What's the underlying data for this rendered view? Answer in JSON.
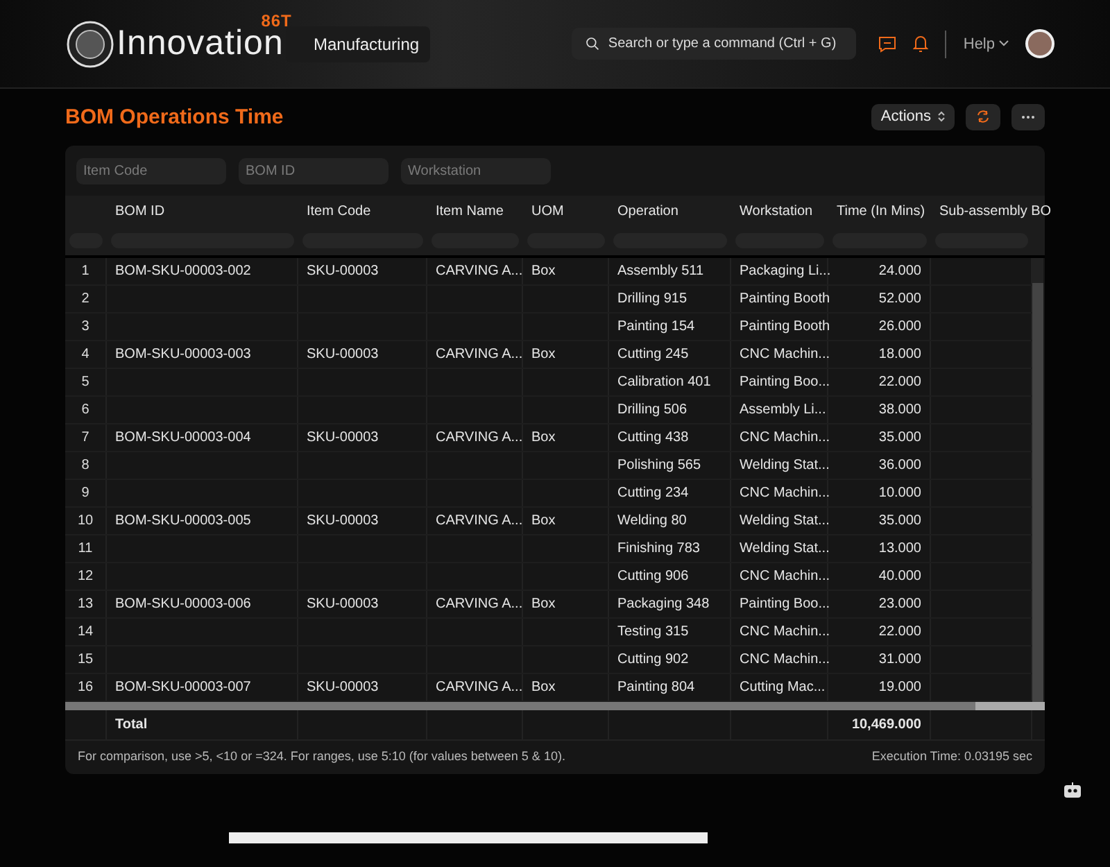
{
  "topbar": {
    "brand": "Innovation",
    "brand_badge": "86T",
    "breadcrumb": "Manufacturing",
    "search": {
      "placeholder": "Search or type a command (Ctrl + G)"
    },
    "help": "Help"
  },
  "page": {
    "title": "BOM Operations Time",
    "actions": "Actions"
  },
  "filters": [
    {
      "placeholder": "Item Code"
    },
    {
      "placeholder": "BOM ID"
    },
    {
      "placeholder": "Workstation"
    }
  ],
  "table": {
    "columns": [
      {
        "label": "BOM ID",
        "kind": "text"
      },
      {
        "label": "Item Code",
        "kind": "text"
      },
      {
        "label": "Item Name",
        "kind": "text"
      },
      {
        "label": "UOM",
        "kind": "text"
      },
      {
        "label": "Operation",
        "kind": "text"
      },
      {
        "label": "Workstation",
        "kind": "text"
      },
      {
        "label": "Time (In Mins)",
        "kind": "number"
      },
      {
        "label": "Sub-assembly BO",
        "kind": "text"
      }
    ],
    "rows": [
      {
        "index": "1",
        "bom_id": "BOM-SKU-00003-002",
        "item_code": "SKU-00003",
        "item_name": "CARVING A...",
        "uom": "Box",
        "operation": "Assembly 511",
        "workstation": "Packaging Li...",
        "time": "24.000"
      },
      {
        "index": "2",
        "operation": "Drilling 915",
        "workstation": "Painting Booth",
        "time": "52.000"
      },
      {
        "index": "3",
        "operation": "Painting 154",
        "workstation": "Painting Booth",
        "time": "26.000"
      },
      {
        "index": "4",
        "bom_id": "BOM-SKU-00003-003",
        "item_code": "SKU-00003",
        "item_name": "CARVING A...",
        "uom": "Box",
        "operation": "Cutting 245",
        "workstation": "CNC Machin...",
        "time": "18.000"
      },
      {
        "index": "5",
        "operation": "Calibration 401",
        "workstation": "Painting Boo...",
        "time": "22.000"
      },
      {
        "index": "6",
        "operation": "Drilling 506",
        "workstation": "Assembly Li...",
        "time": "38.000"
      },
      {
        "index": "7",
        "bom_id": "BOM-SKU-00003-004",
        "item_code": "SKU-00003",
        "item_name": "CARVING A...",
        "uom": "Box",
        "operation": "Cutting 438",
        "workstation": "CNC Machin...",
        "time": "35.000"
      },
      {
        "index": "8",
        "operation": "Polishing 565",
        "workstation": "Welding Stat...",
        "time": "36.000"
      },
      {
        "index": "9",
        "operation": "Cutting 234",
        "workstation": "CNC Machin...",
        "time": "10.000"
      },
      {
        "index": "10",
        "bom_id": "BOM-SKU-00003-005",
        "item_code": "SKU-00003",
        "item_name": "CARVING A...",
        "uom": "Box",
        "operation": "Welding 80",
        "workstation": "Welding Stat...",
        "time": "35.000"
      },
      {
        "index": "11",
        "operation": "Finishing 783",
        "workstation": "Welding Stat...",
        "time": "13.000"
      },
      {
        "index": "12",
        "operation": "Cutting 906",
        "workstation": "CNC Machin...",
        "time": "40.000"
      },
      {
        "index": "13",
        "bom_id": "BOM-SKU-00003-006",
        "item_code": "SKU-00003",
        "item_name": "CARVING A...",
        "uom": "Box",
        "operation": "Packaging 348",
        "workstation": "Painting Boo...",
        "time": "23.000"
      },
      {
        "index": "14",
        "operation": "Testing 315",
        "workstation": "CNC Machin...",
        "time": "22.000"
      },
      {
        "index": "15",
        "operation": "Cutting 902",
        "workstation": "CNC Machin...",
        "time": "31.000"
      },
      {
        "index": "16",
        "bom_id": "BOM-SKU-00003-007",
        "item_code": "SKU-00003",
        "item_name": "CARVING A...",
        "uom": "Box",
        "operation": "Painting 804",
        "workstation": "Cutting Mac...",
        "time": "19.000"
      }
    ],
    "total": {
      "label": "Total",
      "time": "10,469.000"
    }
  },
  "footer": {
    "hint": "For comparison, use >5, <10 or =324. For ranges, use 5:10 (for values between 5 & 10).",
    "execution_time": "Execution Time: 0.03195 sec"
  }
}
